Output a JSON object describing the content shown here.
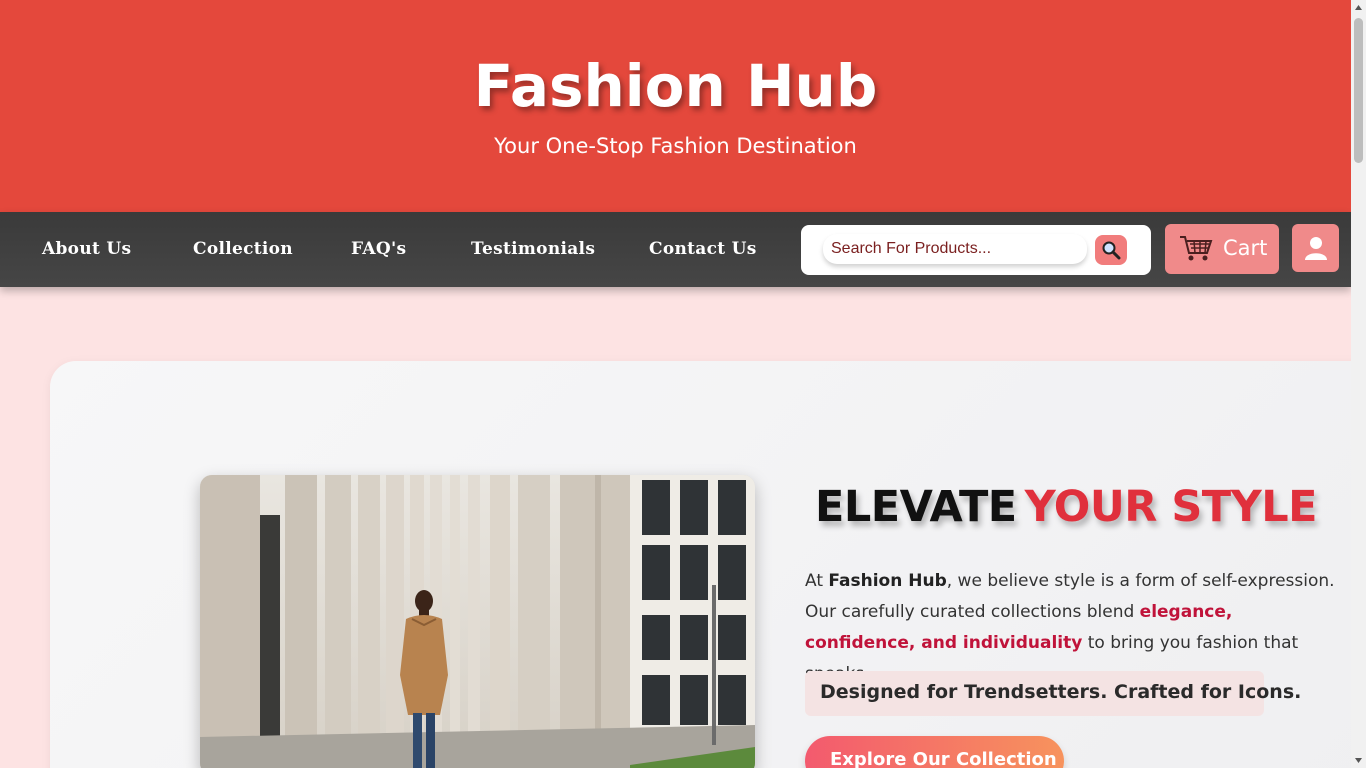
{
  "header": {
    "title": "Fashion Hub",
    "tagline": "Your One-Stop Fashion Destination"
  },
  "nav": {
    "links": [
      "About Us",
      "Collection",
      "FAQ's",
      "Testimonials",
      "Contact Us"
    ],
    "search_placeholder": "Search For Products...",
    "cart_label": "Cart"
  },
  "hero": {
    "title_part1": "ELEVATE",
    "title_part2": "YOUR STYLE",
    "text_before": "At ",
    "text_brand": "Fashion Hub",
    "text_middle": ", we believe style is a form of self-expression. Our carefully curated collections blend ",
    "text_highlight": "elegance, confidence, and individuality",
    "text_after": " to bring you fashion that speaks.",
    "tagline": "Designed for Trendsetters. Crafted for Icons.",
    "button_label": "Explore Our Collection"
  },
  "colors": {
    "header_bg": "#e4483c",
    "nav_bg": "#3a3a3a",
    "accent": "#e0303c",
    "page_bg": "#fde3e3"
  },
  "icons": [
    "search-icon",
    "cart-icon",
    "user-icon"
  ]
}
